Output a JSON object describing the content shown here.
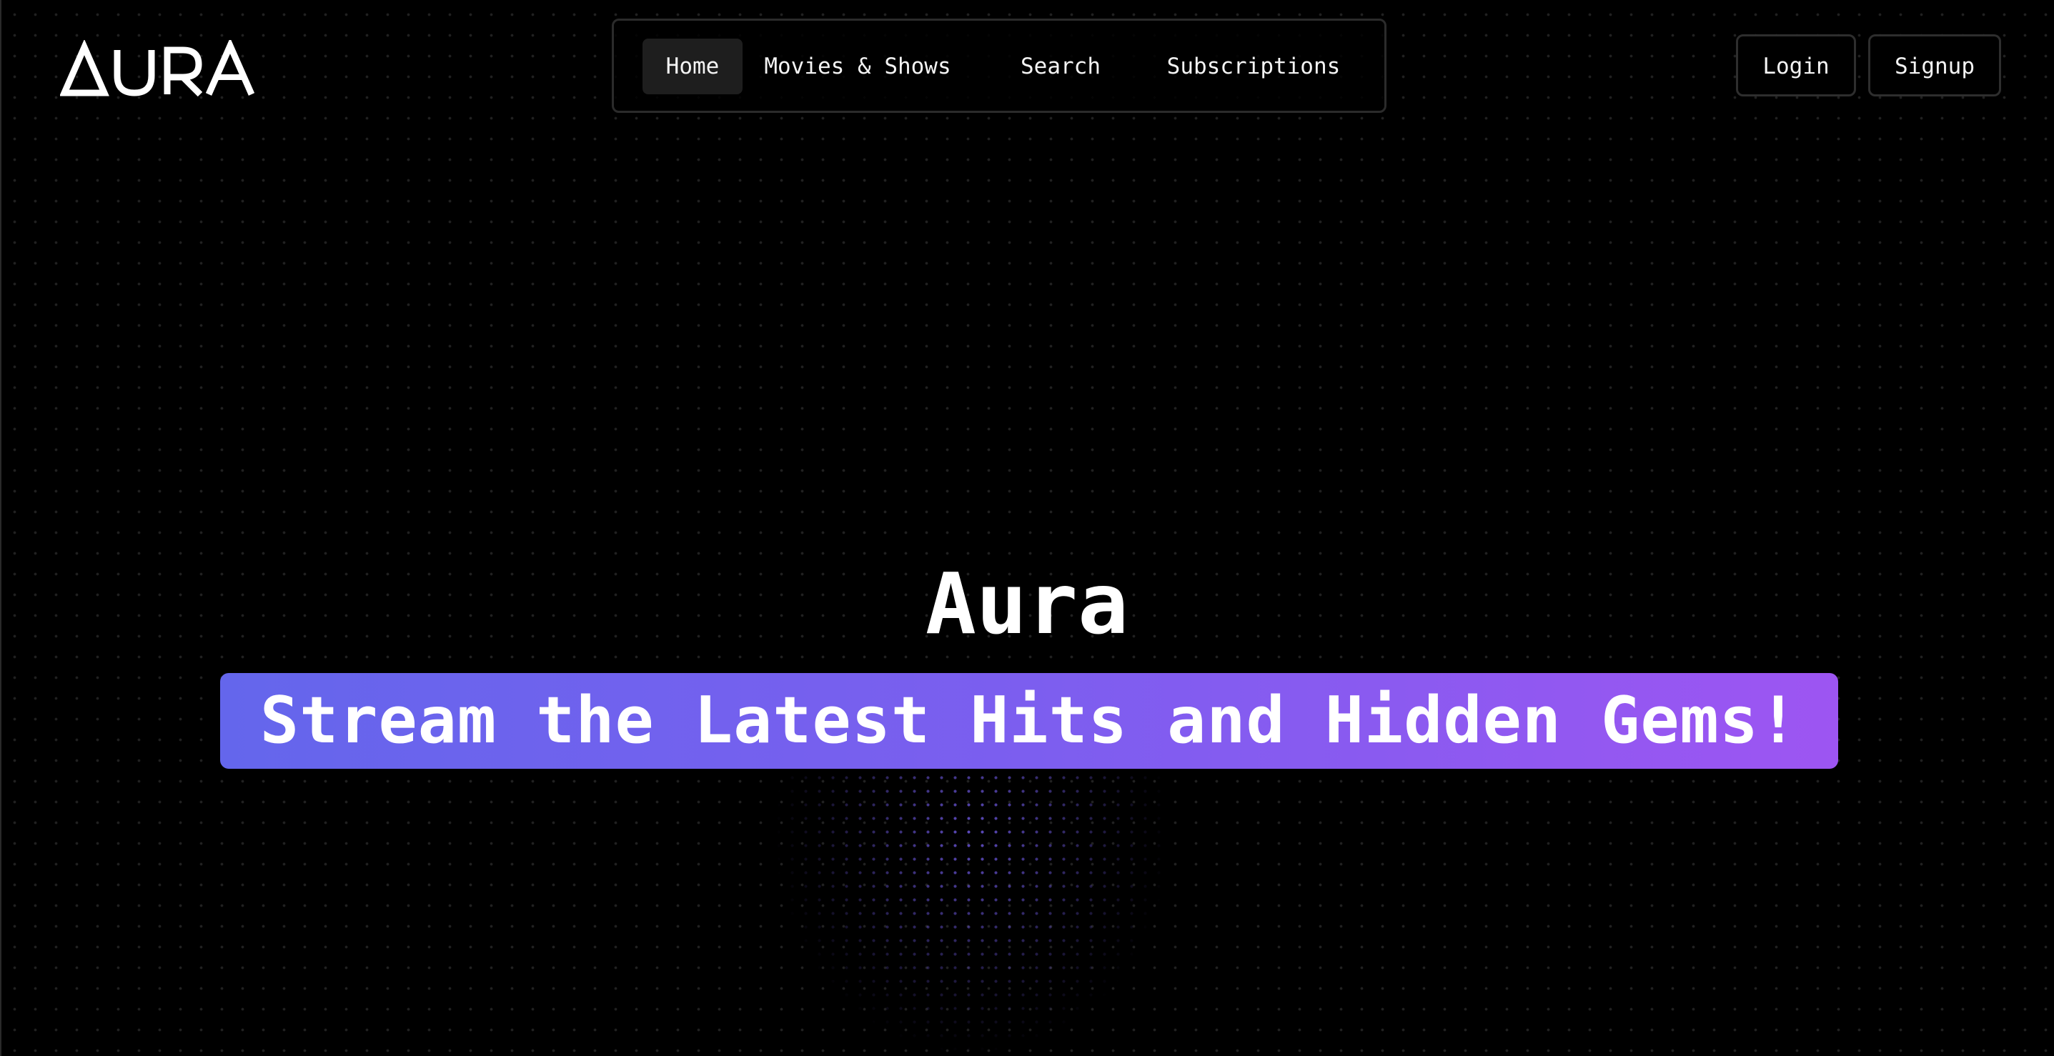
{
  "header": {
    "logo_text": "AURA",
    "nav": [
      {
        "label": "Home",
        "active": true
      },
      {
        "label": "Movies & Shows",
        "active": false
      },
      {
        "label": "Search",
        "active": false
      },
      {
        "label": "Subscriptions",
        "active": false
      }
    ],
    "login_label": "Login",
    "signup_label": "Signup"
  },
  "hero": {
    "title": "Aura",
    "tagline": "Stream the Latest Hits and Hidden Gems!"
  },
  "colors": {
    "background": "#000000",
    "gradient_start": "#6466ec",
    "gradient_end": "#9d55f2",
    "glow_dots": "#7c64ff",
    "border": "#2b2b2b",
    "text": "#ffffff"
  },
  "icons": {
    "logo": "aura-logo-icon"
  }
}
